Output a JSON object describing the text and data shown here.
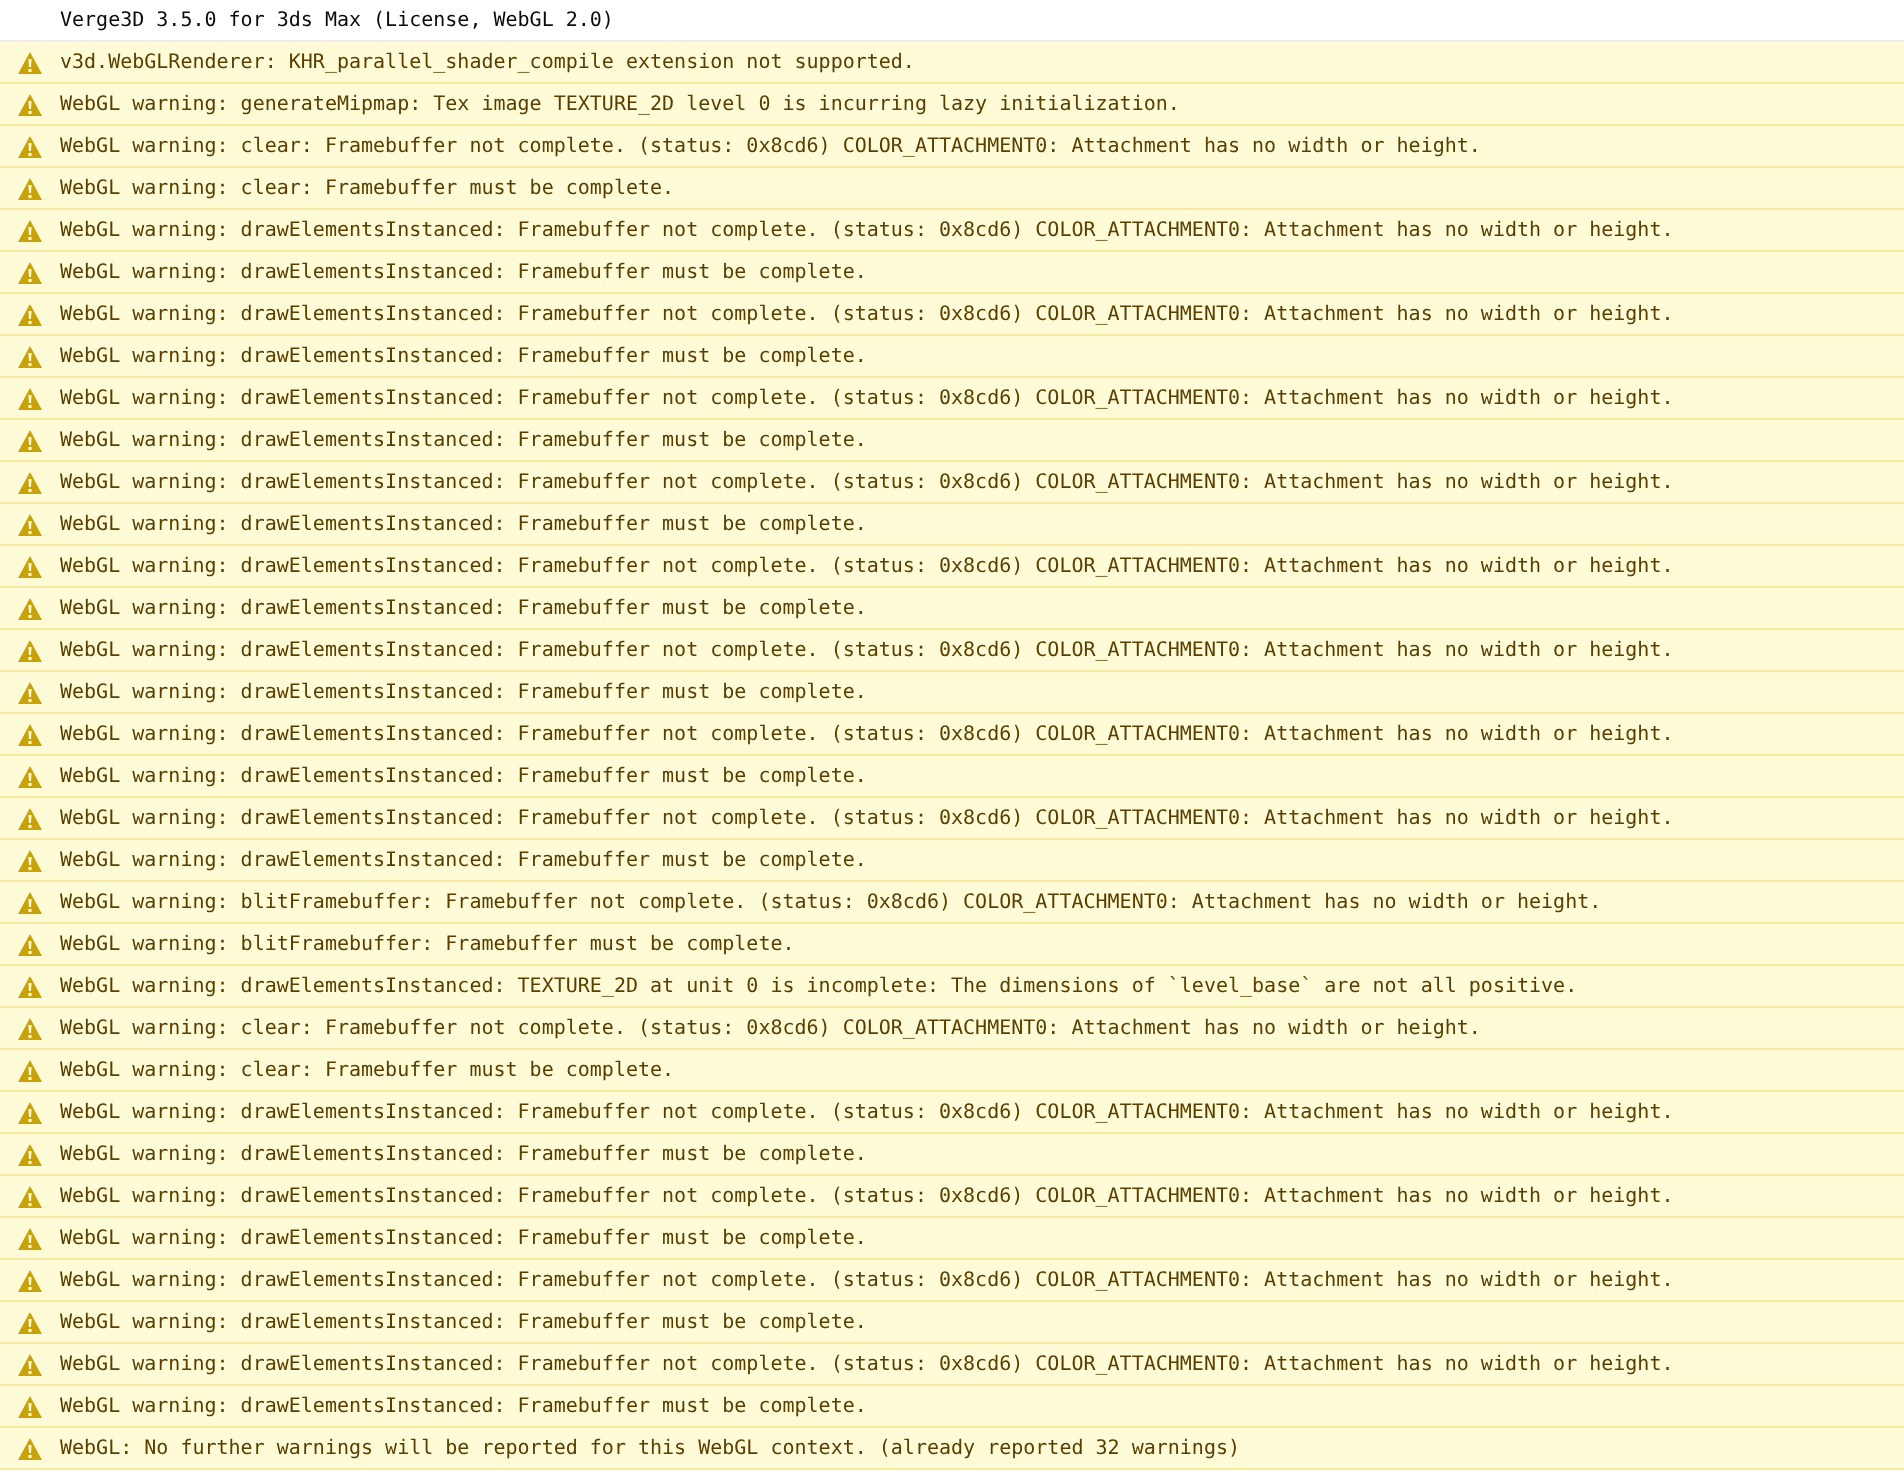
{
  "console": {
    "messages": [
      {
        "kind": "log",
        "text": "Verge3D 3.5.0 for 3ds Max (License, WebGL 2.0)"
      },
      {
        "kind": "warning",
        "text": "v3d.WebGLRenderer: KHR_parallel_shader_compile extension not supported."
      },
      {
        "kind": "warning",
        "text": "WebGL warning: generateMipmap: Tex image TEXTURE_2D level 0 is incurring lazy initialization."
      },
      {
        "kind": "warning",
        "text": "WebGL warning: clear: Framebuffer not complete. (status: 0x8cd6) COLOR_ATTACHMENT0: Attachment has no width or height."
      },
      {
        "kind": "warning",
        "text": "WebGL warning: clear: Framebuffer must be complete."
      },
      {
        "kind": "warning",
        "text": "WebGL warning: drawElementsInstanced: Framebuffer not complete. (status: 0x8cd6) COLOR_ATTACHMENT0: Attachment has no width or height."
      },
      {
        "kind": "warning",
        "text": "WebGL warning: drawElementsInstanced: Framebuffer must be complete."
      },
      {
        "kind": "warning",
        "text": "WebGL warning: drawElementsInstanced: Framebuffer not complete. (status: 0x8cd6) COLOR_ATTACHMENT0: Attachment has no width or height."
      },
      {
        "kind": "warning",
        "text": "WebGL warning: drawElementsInstanced: Framebuffer must be complete."
      },
      {
        "kind": "warning",
        "text": "WebGL warning: drawElementsInstanced: Framebuffer not complete. (status: 0x8cd6) COLOR_ATTACHMENT0: Attachment has no width or height."
      },
      {
        "kind": "warning",
        "text": "WebGL warning: drawElementsInstanced: Framebuffer must be complete."
      },
      {
        "kind": "warning",
        "text": "WebGL warning: drawElementsInstanced: Framebuffer not complete. (status: 0x8cd6) COLOR_ATTACHMENT0: Attachment has no width or height."
      },
      {
        "kind": "warning",
        "text": "WebGL warning: drawElementsInstanced: Framebuffer must be complete."
      },
      {
        "kind": "warning",
        "text": "WebGL warning: drawElementsInstanced: Framebuffer not complete. (status: 0x8cd6) COLOR_ATTACHMENT0: Attachment has no width or height."
      },
      {
        "kind": "warning",
        "text": "WebGL warning: drawElementsInstanced: Framebuffer must be complete."
      },
      {
        "kind": "warning",
        "text": "WebGL warning: drawElementsInstanced: Framebuffer not complete. (status: 0x8cd6) COLOR_ATTACHMENT0: Attachment has no width or height."
      },
      {
        "kind": "warning",
        "text": "WebGL warning: drawElementsInstanced: Framebuffer must be complete."
      },
      {
        "kind": "warning",
        "text": "WebGL warning: drawElementsInstanced: Framebuffer not complete. (status: 0x8cd6) COLOR_ATTACHMENT0: Attachment has no width or height."
      },
      {
        "kind": "warning",
        "text": "WebGL warning: drawElementsInstanced: Framebuffer must be complete."
      },
      {
        "kind": "warning",
        "text": "WebGL warning: drawElementsInstanced: Framebuffer not complete. (status: 0x8cd6) COLOR_ATTACHMENT0: Attachment has no width or height."
      },
      {
        "kind": "warning",
        "text": "WebGL warning: drawElementsInstanced: Framebuffer must be complete."
      },
      {
        "kind": "warning",
        "text": "WebGL warning: blitFramebuffer: Framebuffer not complete. (status: 0x8cd6) COLOR_ATTACHMENT0: Attachment has no width or height."
      },
      {
        "kind": "warning",
        "text": "WebGL warning: blitFramebuffer: Framebuffer must be complete."
      },
      {
        "kind": "warning",
        "text": "WebGL warning: drawElementsInstanced: TEXTURE_2D at unit 0 is incomplete: The dimensions of `level_base` are not all positive."
      },
      {
        "kind": "warning",
        "text": "WebGL warning: clear: Framebuffer not complete. (status: 0x8cd6) COLOR_ATTACHMENT0: Attachment has no width or height."
      },
      {
        "kind": "warning",
        "text": "WebGL warning: clear: Framebuffer must be complete."
      },
      {
        "kind": "warning",
        "text": "WebGL warning: drawElementsInstanced: Framebuffer not complete. (status: 0x8cd6) COLOR_ATTACHMENT0: Attachment has no width or height."
      },
      {
        "kind": "warning",
        "text": "WebGL warning: drawElementsInstanced: Framebuffer must be complete."
      },
      {
        "kind": "warning",
        "text": "WebGL warning: drawElementsInstanced: Framebuffer not complete. (status: 0x8cd6) COLOR_ATTACHMENT0: Attachment has no width or height."
      },
      {
        "kind": "warning",
        "text": "WebGL warning: drawElementsInstanced: Framebuffer must be complete."
      },
      {
        "kind": "warning",
        "text": "WebGL warning: drawElementsInstanced: Framebuffer not complete. (status: 0x8cd6) COLOR_ATTACHMENT0: Attachment has no width or height."
      },
      {
        "kind": "warning",
        "text": "WebGL warning: drawElementsInstanced: Framebuffer must be complete."
      },
      {
        "kind": "warning",
        "text": "WebGL warning: drawElementsInstanced: Framebuffer not complete. (status: 0x8cd6) COLOR_ATTACHMENT0: Attachment has no width or height."
      },
      {
        "kind": "warning",
        "text": "WebGL warning: drawElementsInstanced: Framebuffer must be complete."
      },
      {
        "kind": "warning",
        "text": "WebGL: No further warnings will be reported for this WebGL context. (already reported 32 warnings)"
      }
    ]
  }
}
